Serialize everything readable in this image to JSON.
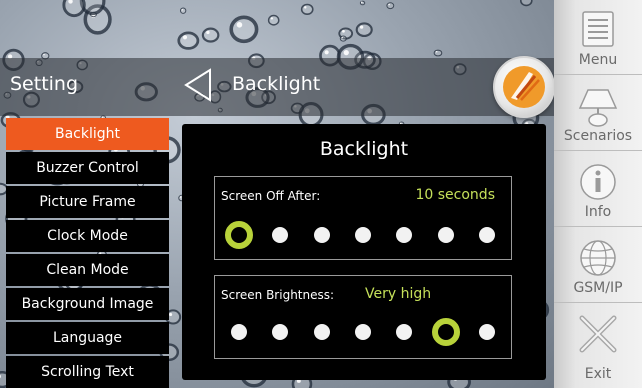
{
  "header": {
    "section_title": "Setting",
    "page_title": "Backlight"
  },
  "menu": {
    "items": [
      {
        "label": "Backlight",
        "active": true
      },
      {
        "label": "Buzzer Control"
      },
      {
        "label": "Picture Frame"
      },
      {
        "label": "Clock Mode"
      },
      {
        "label": "Clean Mode"
      },
      {
        "label": "Background Image"
      },
      {
        "label": "Language"
      },
      {
        "label": "Scrolling Text"
      }
    ]
  },
  "panel": {
    "title": "Backlight",
    "screen_off": {
      "label": "Screen Off After:",
      "value": "10 seconds",
      "levels": 7,
      "selected_index": 0
    },
    "brightness": {
      "label": "Screen Brightness:",
      "value": "Very high",
      "levels": 7,
      "selected_index": 5
    }
  },
  "sidebar": {
    "buttons": [
      {
        "label": "Menu",
        "icon": "menu-list-icon"
      },
      {
        "label": "Scenarios",
        "icon": "scenarios-lamp-icon"
      },
      {
        "label": "Info",
        "icon": "info-icon"
      },
      {
        "label": "GSM/IP",
        "icon": "globe-icon"
      },
      {
        "label": "Exit",
        "icon": "exit-x-icon"
      }
    ]
  },
  "colors": {
    "accent_orange": "#ee5a1f",
    "value_green": "#c5e05a",
    "selected_ring": "#b8d23a"
  }
}
